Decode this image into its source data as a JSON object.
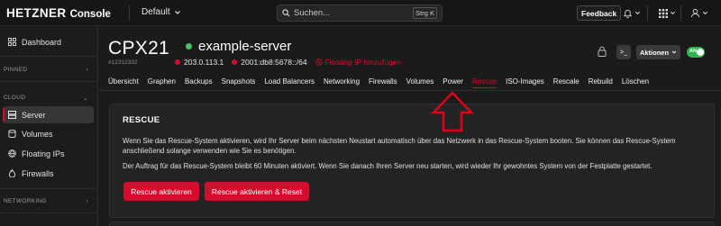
{
  "header": {
    "logo": "HETZNER",
    "app_name": "Console",
    "project": "Default",
    "search_placeholder": "Suchen...",
    "search_shortcut": "Strg K",
    "feedback_label": "Feedback"
  },
  "sidebar": {
    "dashboard": "Dashboard",
    "section_pinned": "PINNED",
    "section_cloud": "CLOUD",
    "items": [
      {
        "label": "Server"
      },
      {
        "label": "Volumes"
      },
      {
        "label": "Floating IPs"
      },
      {
        "label": "Firewalls"
      }
    ],
    "section_networking": "NETWORKING"
  },
  "server": {
    "type": "CPX21",
    "id": "#12312332",
    "name": "example-server",
    "ipv4": "203.0.113.1",
    "ipv6": "2001:db8:5678::/64",
    "floating_ip_label": "Floating IP hinzufügen",
    "actions_label": "Aktionen",
    "power_label": "AN",
    "console_label": ">_"
  },
  "tabs": [
    "Übersicht",
    "Graphen",
    "Backups",
    "Snapshots",
    "Load Balancers",
    "Networking",
    "Firewalls",
    "Volumes",
    "Power",
    "Rescue",
    "ISO-Images",
    "Rescale",
    "Rebuild",
    "Löschen"
  ],
  "active_tab": "Rescue",
  "rescue": {
    "title": "RESCUE",
    "paragraph1": "Wenn Sie das Rescue-System aktivieren, wird Ihr Server beim nächsten Neustart automatisch über das Netzwerk in das Rescue-System booten. Sie können das Rescue-System anschließend solange verwenden wie Sie es benötigen.",
    "paragraph2": "Der Auftrag für das Rescue-System bleibt 60 Minuten aktiviert. Wenn Sie danach Ihren Server neu starten, wird wieder Ihr gewohntes System von der Festplatte gestartet.",
    "button_activate": "Rescue aktivieren",
    "button_activate_reset": "Rescue aktivieren & Reset"
  },
  "colors": {
    "accent": "#d50c2d",
    "status_on": "#2fb34f",
    "background": "#1b1b1b"
  }
}
